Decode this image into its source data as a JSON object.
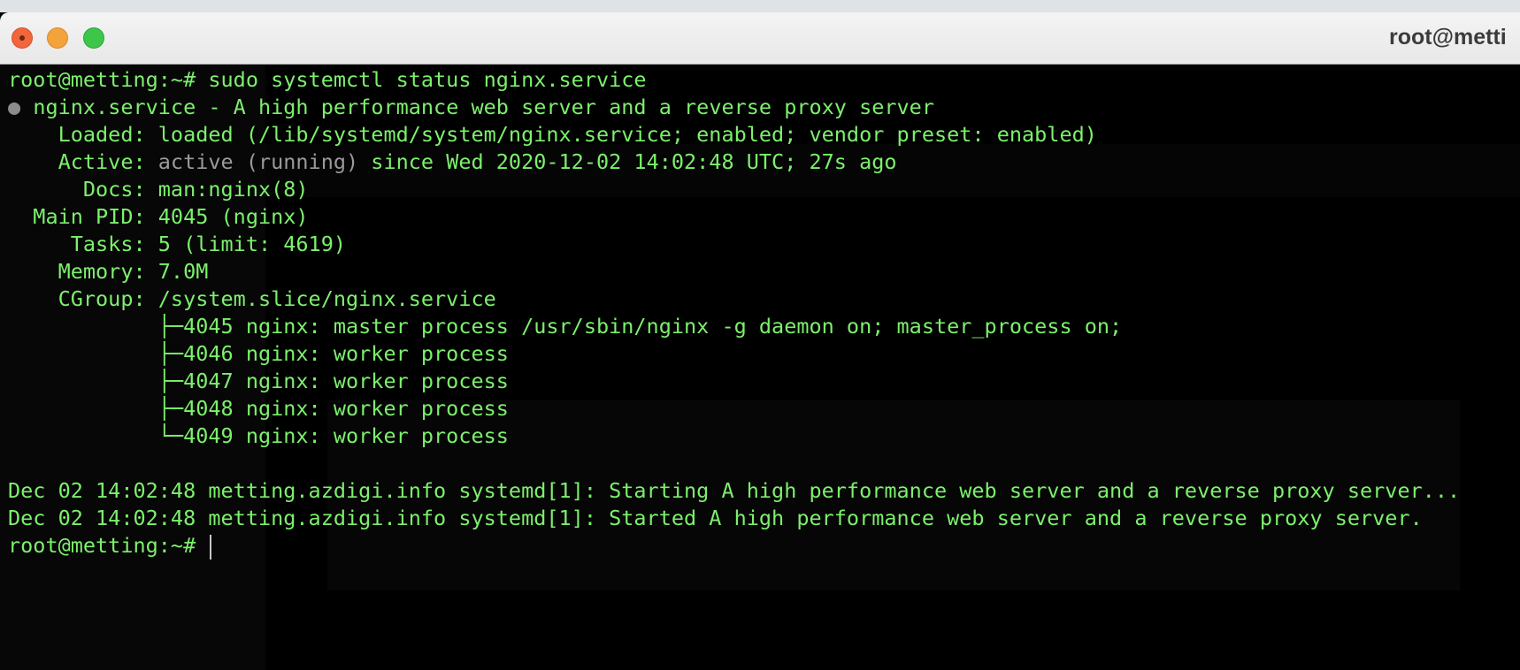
{
  "window": {
    "title": "root@metti"
  },
  "terminal": {
    "prompt_line": "root@metting:~# sudo systemctl status nginx.service",
    "service_header": "nginx.service - A high performance web server and a reverse proxy server",
    "loaded": "    Loaded: loaded (/lib/systemd/system/nginx.service; enabled; vendor preset: enabled)",
    "active_prefix": "    Active: ",
    "active_state": "active (running)",
    "active_suffix": " since Wed 2020-12-02 14:02:48 UTC; 27s ago",
    "docs": "      Docs: man:nginx(8)",
    "main_pid": "  Main PID: 4045 (nginx)",
    "tasks": "     Tasks: 5 (limit: 4619)",
    "memory": "    Memory: 7.0M",
    "cgroup": "    CGroup: /system.slice/nginx.service",
    "processes": [
      "            ├─4045 nginx: master process /usr/sbin/nginx -g daemon on; master_process on;",
      "            ├─4046 nginx: worker process",
      "            ├─4047 nginx: worker process",
      "            ├─4048 nginx: worker process",
      "            └─4049 nginx: worker process"
    ],
    "log_lines": [
      "Dec 02 14:02:48 metting.azdigi.info systemd[1]: Starting A high performance web server and a reverse proxy server...",
      "Dec 02 14:02:48 metting.azdigi.info systemd[1]: Started A high performance web server and a reverse proxy server."
    ],
    "final_prompt": "root@metting:~# "
  },
  "colors": {
    "terminal_text": "#7cf06c",
    "terminal_bg": "#000000"
  }
}
